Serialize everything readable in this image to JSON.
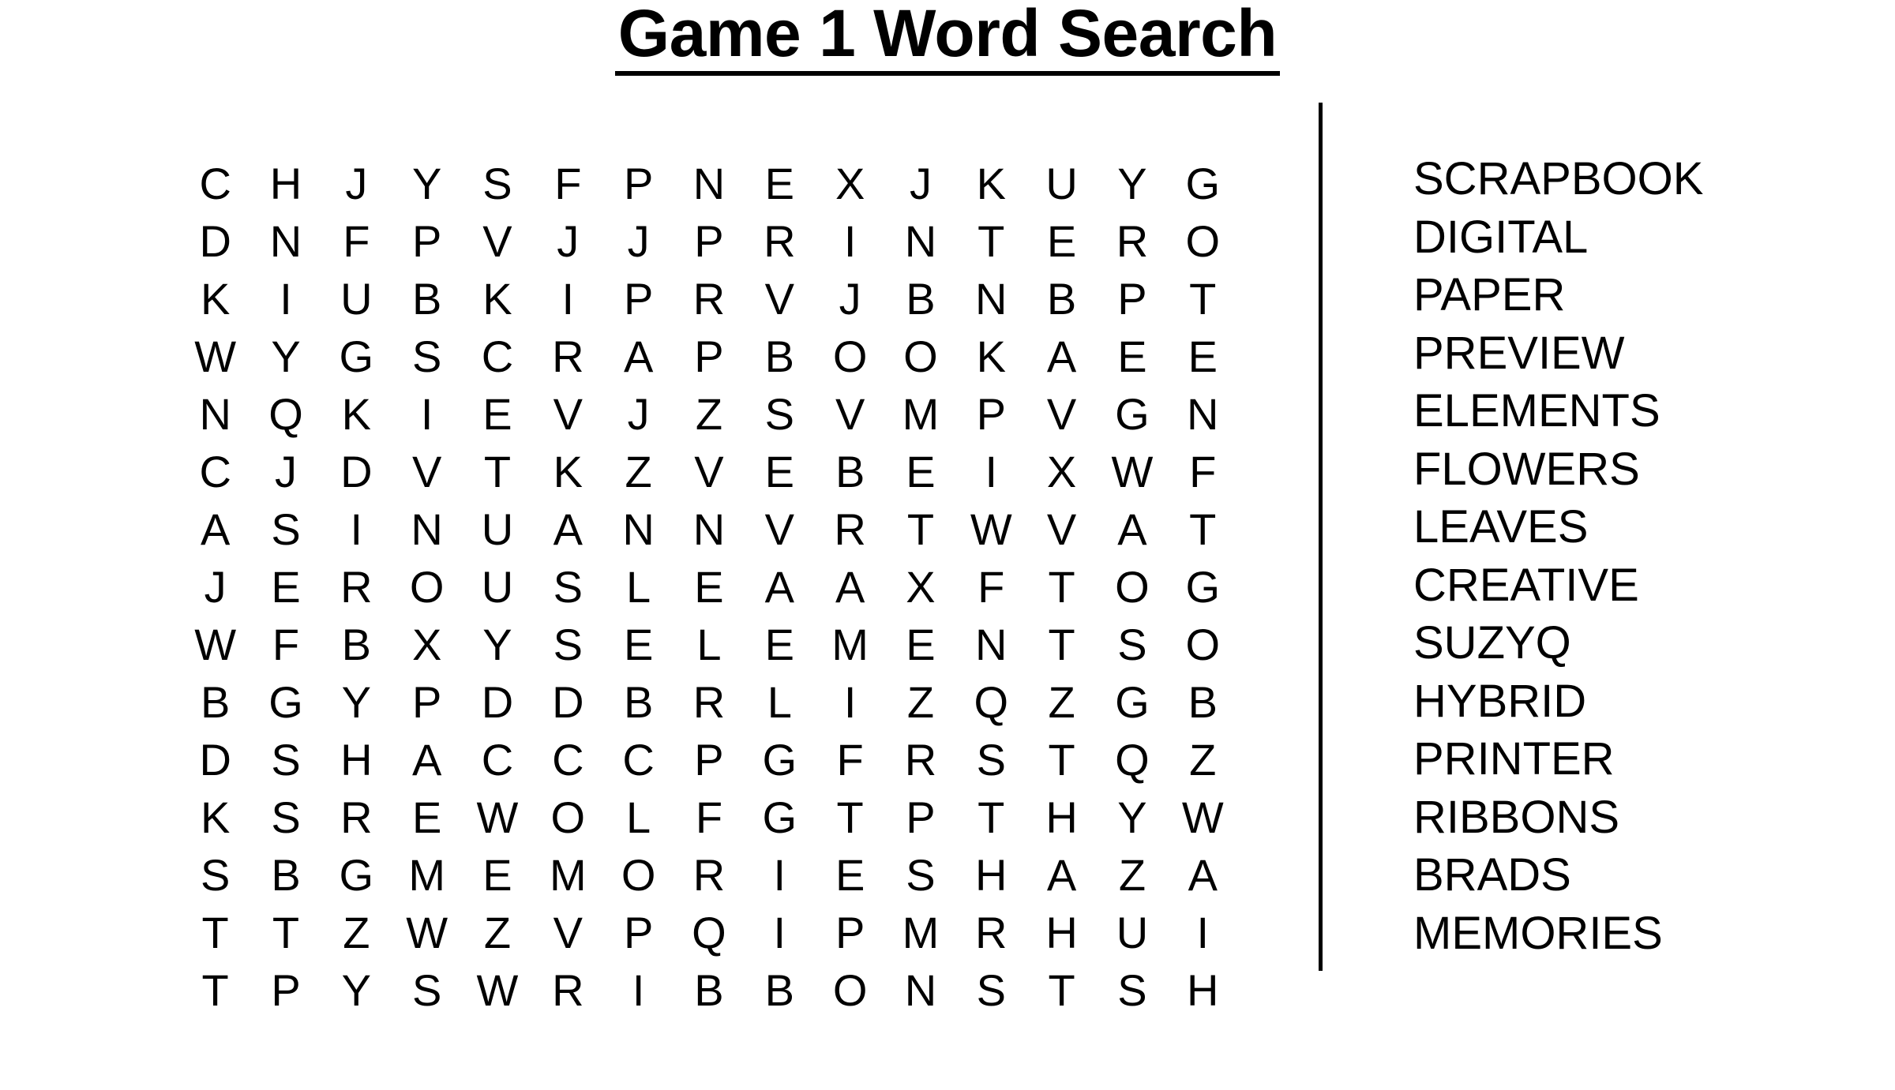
{
  "title": "Game 1 Word Search",
  "colors": {
    "text": "#000000",
    "background": "#ffffff",
    "divider": "#000000"
  },
  "grid": {
    "columns": 14,
    "rows": 16,
    "letters": [
      [
        "C",
        "H",
        "J",
        "Y",
        "S",
        "F",
        "P",
        "N",
        "E",
        "X",
        "J",
        "K",
        "U",
        "Y",
        "G"
      ],
      [
        "D",
        "N",
        "F",
        "P",
        "V",
        "J",
        "J",
        "P",
        "R",
        "I",
        "N",
        "T",
        "E",
        "R",
        "O"
      ],
      [
        "K",
        "I",
        "U",
        "B",
        "K",
        "I",
        "P",
        "R",
        "V",
        "J",
        "B",
        "N",
        "B",
        "P",
        "T"
      ],
      [
        "W",
        "Y",
        "G",
        "S",
        "C",
        "R",
        "A",
        "P",
        "B",
        "O",
        "O",
        "K",
        "A",
        "E",
        "E"
      ],
      [
        "N",
        "Q",
        "K",
        "I",
        "E",
        "V",
        "J",
        "Z",
        "S",
        "V",
        "M",
        "P",
        "V",
        "G",
        "N"
      ],
      [
        "C",
        "J",
        "D",
        "V",
        "T",
        "K",
        "Z",
        "V",
        "E",
        "B",
        "E",
        "I",
        "X",
        "W",
        "F"
      ],
      [
        "A",
        "S",
        "I",
        "N",
        "U",
        "A",
        "N",
        "N",
        "V",
        "R",
        "T",
        "W",
        "V",
        "A",
        "T"
      ],
      [
        "J",
        "E",
        "R",
        "O",
        "U",
        "S",
        "L",
        "E",
        "A",
        "A",
        "X",
        "F",
        "T",
        "O",
        "G"
      ],
      [
        "W",
        "F",
        "B",
        "X",
        "Y",
        "S",
        "E",
        "L",
        "E",
        "M",
        "E",
        "N",
        "T",
        "S",
        "O"
      ],
      [
        "B",
        "G",
        "Y",
        "P",
        "D",
        "D",
        "B",
        "R",
        "L",
        "I",
        "Z",
        "Q",
        "Z",
        "G",
        "B"
      ],
      [
        "D",
        "S",
        "H",
        "A",
        "C",
        "C",
        "C",
        "P",
        "G",
        "F",
        "R",
        "S",
        "T",
        "Q",
        "Z"
      ],
      [
        "K",
        "S",
        "R",
        "E",
        "W",
        "O",
        "L",
        "F",
        "G",
        "T",
        "P",
        "T",
        "H",
        "Y",
        "W"
      ],
      [
        "S",
        "B",
        "G",
        "M",
        "E",
        "M",
        "O",
        "R",
        "I",
        "E",
        "S",
        "H",
        "A",
        "Z",
        "A"
      ],
      [
        "T",
        "T",
        "Z",
        "W",
        "Z",
        "V",
        "P",
        "Q",
        "I",
        "P",
        "M",
        "R",
        "H",
        "U",
        "I"
      ],
      [
        "T",
        "P",
        "Y",
        "S",
        "W",
        "R",
        "I",
        "B",
        "B",
        "O",
        "N",
        "S",
        "T",
        "S",
        "H"
      ]
    ]
  },
  "wordlist": {
    "words": [
      "SCRAPBOOK",
      "DIGITAL",
      "PAPER",
      "PREVIEW",
      "ELEMENTS",
      "FLOWERS",
      "LEAVES",
      "CREATIVE",
      "SUZYQ",
      "HYBRID",
      "PRINTER",
      "RIBBONS",
      "BRADS",
      "MEMORIES"
    ]
  }
}
